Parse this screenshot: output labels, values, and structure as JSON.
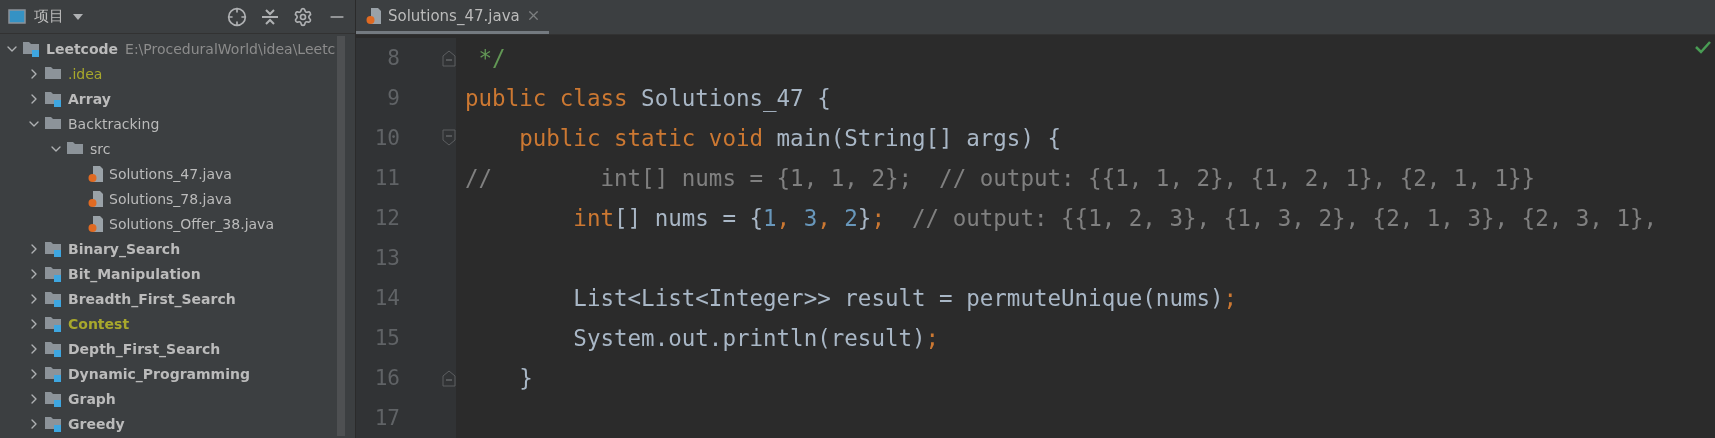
{
  "project_panel": {
    "title": "项目",
    "tree": [
      {
        "label": "Leetcode",
        "kind": "module",
        "path": "E:\\ProceduralWorld\\idea\\Leetc",
        "expanded": true,
        "color": "#bbbbbb",
        "children": [
          {
            "label": ".idea",
            "kind": "folder",
            "expanded": false,
            "color": "#a8a82c"
          },
          {
            "label": "Array",
            "kind": "module",
            "expanded": false,
            "color": "#bbbbbb"
          },
          {
            "label": "Backtracking",
            "kind": "folder",
            "expanded": true,
            "color": "#bbbbbb",
            "children": [
              {
                "label": "src",
                "kind": "folder",
                "expanded": true,
                "color": "#bbbbbb",
                "children": [
                  {
                    "label": "Solutions_47.java",
                    "kind": "java",
                    "color": "#bbbbbb"
                  },
                  {
                    "label": "Solutions_78.java",
                    "kind": "java",
                    "color": "#bbbbbb"
                  },
                  {
                    "label": "Solutions_Offer_38.java",
                    "kind": "java",
                    "color": "#bbbbbb"
                  }
                ]
              }
            ]
          },
          {
            "label": "Binary_Search",
            "kind": "module",
            "expanded": false,
            "color": "#bbbbbb"
          },
          {
            "label": "Bit_Manipulation",
            "kind": "module",
            "expanded": false,
            "color": "#bbbbbb"
          },
          {
            "label": "Breadth_First_Search",
            "kind": "module",
            "expanded": false,
            "color": "#bbbbbb"
          },
          {
            "label": "Contest",
            "kind": "module",
            "expanded": false,
            "color": "#a8a82c"
          },
          {
            "label": "Depth_First_Search",
            "kind": "module",
            "expanded": false,
            "color": "#bbbbbb"
          },
          {
            "label": "Dynamic_Programming",
            "kind": "module",
            "expanded": false,
            "color": "#bbbbbb"
          },
          {
            "label": "Graph",
            "kind": "module",
            "expanded": false,
            "color": "#bbbbbb"
          },
          {
            "label": "Greedy",
            "kind": "module",
            "expanded": false,
            "color": "#bbbbbb"
          }
        ]
      }
    ]
  },
  "tabs": [
    {
      "label": "Solutions_47.java",
      "selected": true
    }
  ],
  "editor": {
    "lines": [
      {
        "number": "8",
        "fold_start": false,
        "fold_end": true,
        "tokens": [
          {
            "kind": "doc",
            "text": " */"
          }
        ]
      },
      {
        "number": "9",
        "fold_start": false,
        "fold_end": false,
        "tokens": [
          {
            "kind": "keyword",
            "text": "public class "
          },
          {
            "kind": "plain",
            "text": "Solutions_47 {"
          }
        ]
      },
      {
        "number": "10",
        "fold_start": true,
        "fold_end": false,
        "tokens": [
          {
            "kind": "keyword",
            "text": "    public static void "
          },
          {
            "kind": "plain",
            "text": "main(String[] args) {"
          }
        ]
      },
      {
        "number": "11",
        "fold_start": false,
        "fold_end": false,
        "tokens": [
          {
            "kind": "comment",
            "text": "//        int[] nums = {1, 1, 2};  // output: {{1, 1, 2}, {1, 2, 1}, {2, 1, 1}}"
          }
        ]
      },
      {
        "number": "12",
        "fold_start": false,
        "fold_end": false,
        "tokens": [
          {
            "kind": "keyword",
            "text": "        int"
          },
          {
            "kind": "plain",
            "text": "[] nums = {"
          },
          {
            "kind": "number",
            "text": "1"
          },
          {
            "kind": "punct",
            "text": ", "
          },
          {
            "kind": "number",
            "text": "3"
          },
          {
            "kind": "punct",
            "text": ", "
          },
          {
            "kind": "number",
            "text": "2"
          },
          {
            "kind": "plain",
            "text": "}"
          },
          {
            "kind": "punct",
            "text": ";"
          },
          {
            "kind": "comment",
            "text": "  // output: {{1, 2, 3}, {1, 3, 2}, {2, 1, 3}, {2, 3, 1},"
          }
        ]
      },
      {
        "number": "13",
        "fold_start": false,
        "fold_end": false
      },
      {
        "number": "14",
        "fold_start": false,
        "fold_end": false,
        "tokens": [
          {
            "kind": "plain",
            "text": "        List<List<Integer>> result = permuteUnique(nums)"
          },
          {
            "kind": "punct",
            "text": ";"
          }
        ]
      },
      {
        "number": "15",
        "fold_start": false,
        "fold_end": false,
        "tokens": [
          {
            "kind": "plain",
            "text": "        System.out.println(result)"
          },
          {
            "kind": "punct",
            "text": ";"
          }
        ]
      },
      {
        "number": "16",
        "fold_start": false,
        "fold_end": true,
        "tokens": [
          {
            "kind": "plain",
            "text": "    }"
          }
        ]
      },
      {
        "number": "17",
        "fold_start": false,
        "fold_end": false
      }
    ]
  }
}
